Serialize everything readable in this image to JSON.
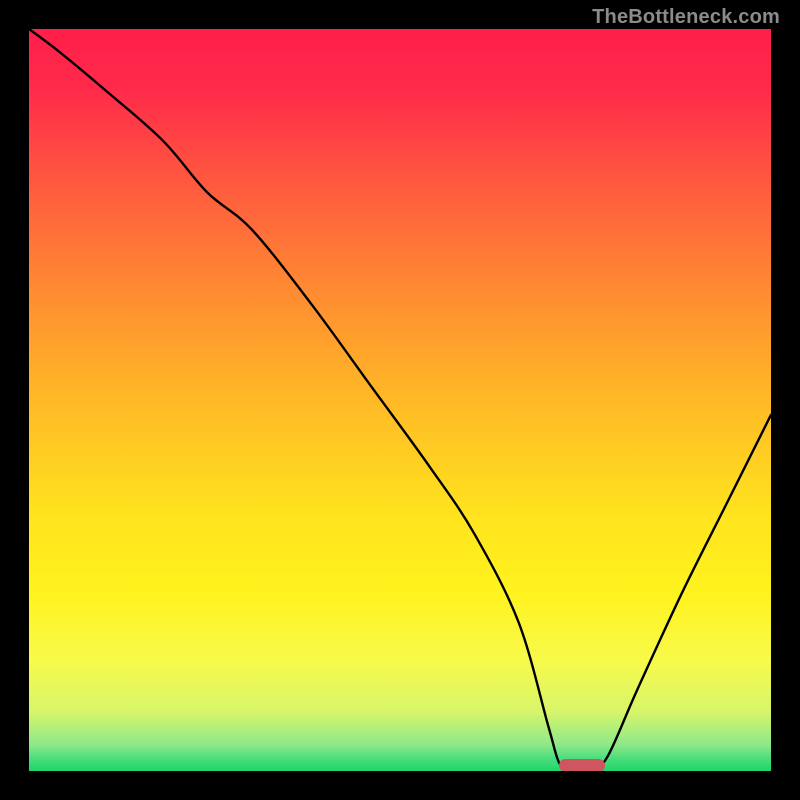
{
  "watermark": "TheBottleneck.com",
  "chart_data": {
    "type": "line",
    "title": "",
    "xlabel": "",
    "ylabel": "",
    "xlim": [
      0,
      100
    ],
    "ylim": [
      0,
      100
    ],
    "grid": false,
    "legend": false,
    "gradient_stops": [
      {
        "pos": 0.0,
        "color": "#ff1f4a"
      },
      {
        "pos": 0.08,
        "color": "#ff2a4a"
      },
      {
        "pos": 0.2,
        "color": "#ff5640"
      },
      {
        "pos": 0.35,
        "color": "#ff8a32"
      },
      {
        "pos": 0.5,
        "color": "#ffb926"
      },
      {
        "pos": 0.65,
        "color": "#ffe21e"
      },
      {
        "pos": 0.76,
        "color": "#fff31e"
      },
      {
        "pos": 0.85,
        "color": "#f8fa4a"
      },
      {
        "pos": 0.92,
        "color": "#d7f56a"
      },
      {
        "pos": 0.965,
        "color": "#8de88a"
      },
      {
        "pos": 0.985,
        "color": "#44dd7a"
      },
      {
        "pos": 1.0,
        "color": "#1fd66b"
      }
    ],
    "series": [
      {
        "name": "bottleneck-curve",
        "color": "#000000",
        "x": [
          0,
          4,
          10,
          18,
          24,
          30,
          38,
          46,
          54,
          60,
          66,
          70,
          71.5,
          73,
          76,
          78,
          82,
          88,
          94,
          100
        ],
        "y": [
          100,
          97,
          92,
          85,
          78,
          73,
          63,
          52,
          41,
          32,
          20,
          6,
          1,
          0.5,
          0.5,
          2,
          11,
          24,
          36,
          48
        ]
      }
    ],
    "marker": {
      "x_center": 74.5,
      "y": 0.7,
      "width_pct": 6.2,
      "height_pct": 1.7,
      "color": "#cf5560"
    }
  }
}
